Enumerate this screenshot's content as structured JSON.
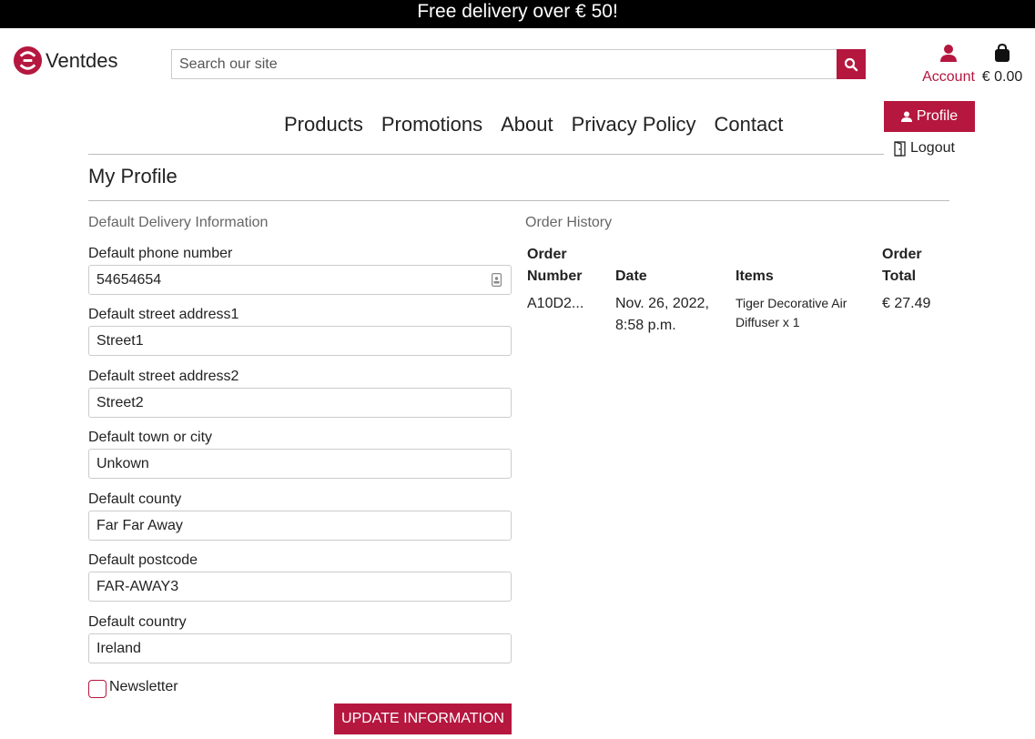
{
  "banner": "Free delivery over € 50!",
  "logo": {
    "text": "Ventdes"
  },
  "search": {
    "placeholder": "Search our site"
  },
  "account": {
    "label": "Account"
  },
  "cart": {
    "total": "€ 0.00"
  },
  "nav": [
    "Products",
    "Promotions",
    "About",
    "Privacy Policy",
    "Contact"
  ],
  "profile_menu": {
    "profile": "Profile",
    "logout": "Logout"
  },
  "page_title": "My Profile",
  "delivery": {
    "heading": "Default Delivery Information",
    "fields": [
      {
        "label": "Default phone number",
        "value": "54654654"
      },
      {
        "label": "Default street address1",
        "value": "Street1"
      },
      {
        "label": "Default street address2",
        "value": "Street2"
      },
      {
        "label": "Default town or city",
        "value": "Unkown"
      },
      {
        "label": "Default county",
        "value": "Far Far Away"
      },
      {
        "label": "Default postcode",
        "value": "FAR-AWAY3"
      },
      {
        "label": "Default country",
        "value": "Ireland"
      }
    ],
    "newsletter": "Newsletter",
    "submit": "UPDATE INFORMATION"
  },
  "orders": {
    "heading": "Order History",
    "headers": {
      "number_1": "Order",
      "number_2": "Number",
      "date": "Date",
      "items": "Items",
      "total_1": "Order",
      "total_2": "Total"
    },
    "rows": [
      {
        "number": "A10D2...",
        "date_1": "Nov. 26, 2022,",
        "date_2": "8:58 p.m.",
        "items_1": "Tiger Decorative Air",
        "items_2": "Diffuser x 1",
        "total": "€ 27.49"
      }
    ]
  },
  "colors": {
    "accent": "#b5173f",
    "banner_bg": "#000000"
  }
}
